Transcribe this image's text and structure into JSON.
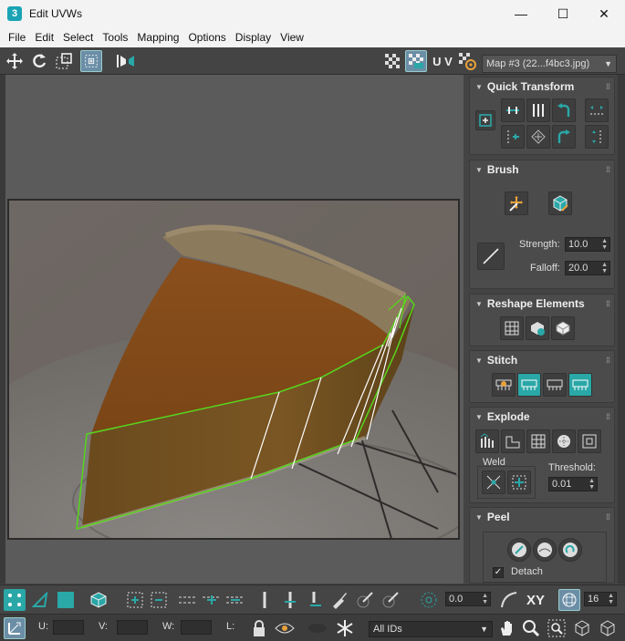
{
  "window": {
    "title": "Edit UVWs",
    "app_icon": "3",
    "minimize": "—",
    "maximize": "☐",
    "close": "✕"
  },
  "menu": [
    "File",
    "Edit",
    "Select",
    "Tools",
    "Mapping",
    "Options",
    "Display",
    "View"
  ],
  "toolbar": {
    "uv_label": "U V",
    "map_selector": "Map #3 (22...f4bc3.jpg)"
  },
  "panel": {
    "quick_transform": {
      "title": "Quick Transform"
    },
    "brush": {
      "title": "Brush",
      "strength_label": "Strength:",
      "strength_value": "10.0",
      "falloff_label": "Falloff:",
      "falloff_value": "20.0"
    },
    "reshape": {
      "title": "Reshape Elements"
    },
    "stitch": {
      "title": "Stitch"
    },
    "explode": {
      "title": "Explode",
      "weld_label": "Weld",
      "threshold_label": "Threshold:",
      "threshold_value": "0.01"
    },
    "peel": {
      "title": "Peel",
      "detach_label": "Detach",
      "detach_checked": true
    }
  },
  "bottom": {
    "spinner_value": "0.0",
    "xy_label": "XY",
    "grid_value": "16",
    "u_label": "U:",
    "v_label": "V:",
    "w_label": "W:",
    "l_label": "L:",
    "ids_dropdown": "All IDs"
  },
  "colors": {
    "accent": "#2aa7a7",
    "selection_edge": "#56d61c",
    "background": "#444444"
  }
}
